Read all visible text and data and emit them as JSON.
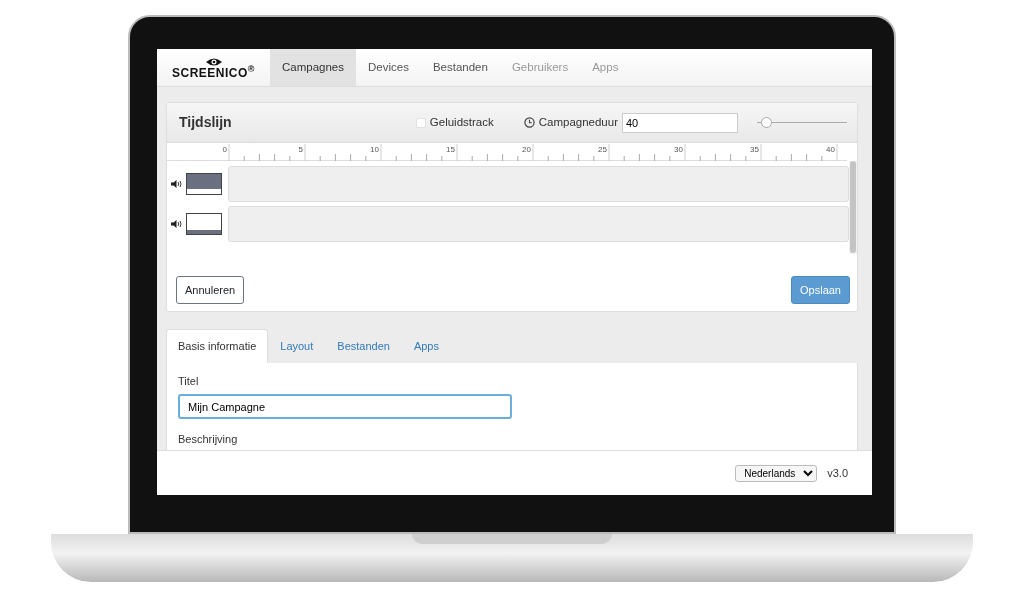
{
  "logo": {
    "text": "SCREENICO$^{®}$"
  },
  "nav": [
    {
      "label": "Campagnes",
      "selected": true,
      "disabled": false
    },
    {
      "label": "Devices",
      "selected": false,
      "disabled": false
    },
    {
      "label": "Bestanden",
      "selected": false,
      "disabled": false
    },
    {
      "label": "Gebruikers",
      "selected": false,
      "disabled": true
    },
    {
      "label": "Apps",
      "selected": false,
      "disabled": true
    }
  ],
  "timeline": {
    "title": "Tijdslijn",
    "sound_track": {
      "label": "Geluidstrack",
      "checked": false
    },
    "duration": {
      "label": "Campagneduur",
      "value": "40"
    },
    "zoom_slider": {
      "level": 0.1
    },
    "ruler_labels": [
      "0",
      "5",
      "10",
      "15",
      "20",
      "25",
      "30",
      "35",
      "40"
    ],
    "tracks": [
      {
        "kind": "dark"
      },
      {
        "kind": "light"
      }
    ],
    "buttons": [
      {
        "label": "Annuleren",
        "kind": "default"
      },
      {
        "label": "Opslaan",
        "kind": "primary"
      }
    ]
  },
  "tabs": [
    {
      "label": "Basis informatie",
      "selected": true
    },
    {
      "label": "Layout",
      "selected": false
    },
    {
      "label": "Bestanden",
      "selected": false
    },
    {
      "label": "Apps",
      "selected": false
    }
  ],
  "form": [
    {
      "label": "Titel",
      "value": "Mijn Campagne"
    },
    {
      "label": "Beschrijving"
    }
  ],
  "footer": {
    "language": "Nederlands",
    "version": "v3.0"
  }
}
